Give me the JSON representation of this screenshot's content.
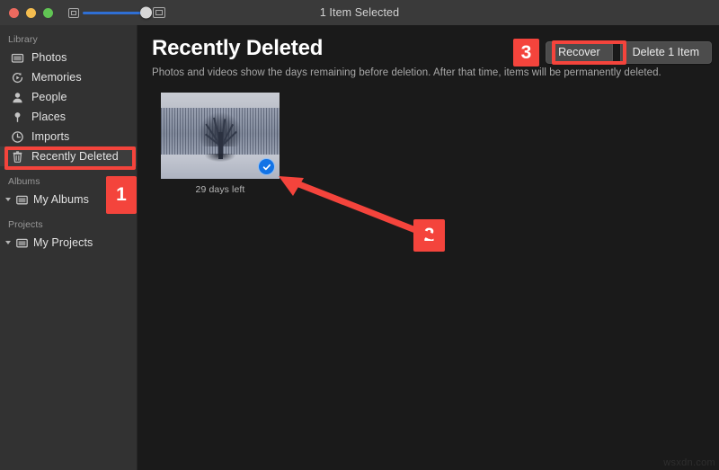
{
  "window": {
    "title": "1 Item Selected",
    "traffic_lights": [
      "close-button",
      "minimize-button",
      "maximize-button"
    ],
    "zoom_slider": {
      "small_icon": "small-thumbnail-icon",
      "large_icon": "large-thumbnail-icon",
      "value": 95
    }
  },
  "sidebar": {
    "sections": [
      {
        "label": "Library",
        "items": [
          {
            "label": "Photos",
            "icon": "photos-icon",
            "selected": false
          },
          {
            "label": "Memories",
            "icon": "memories-icon",
            "selected": false
          },
          {
            "label": "People",
            "icon": "people-icon",
            "selected": false
          },
          {
            "label": "Places",
            "icon": "places-pin-icon",
            "selected": false
          },
          {
            "label": "Imports",
            "icon": "imports-clock-icon",
            "selected": false
          },
          {
            "label": "Recently Deleted",
            "icon": "trash-icon",
            "selected": true
          }
        ]
      },
      {
        "label": "Albums",
        "items": [
          {
            "label": "My Albums",
            "icon": "folder-icon",
            "selected": false
          }
        ]
      },
      {
        "label": "Projects",
        "items": [
          {
            "label": "My Projects",
            "icon": "folder-icon",
            "selected": false
          }
        ]
      }
    ]
  },
  "main": {
    "title": "Recently Deleted",
    "subtitle": "Photos and videos show the days remaining before deletion. After that time, items will be permanently deleted.",
    "recover_label": "Recover",
    "delete_label": "Delete 1 Item",
    "photos": [
      {
        "caption": "29 days left",
        "selected": true,
        "alt": "winter landscape with bare tree"
      }
    ]
  },
  "annotations": {
    "step1": "1",
    "step2": "2",
    "step3": "3",
    "accent_color": "#f4443c"
  },
  "watermark": "wsxdn.com"
}
